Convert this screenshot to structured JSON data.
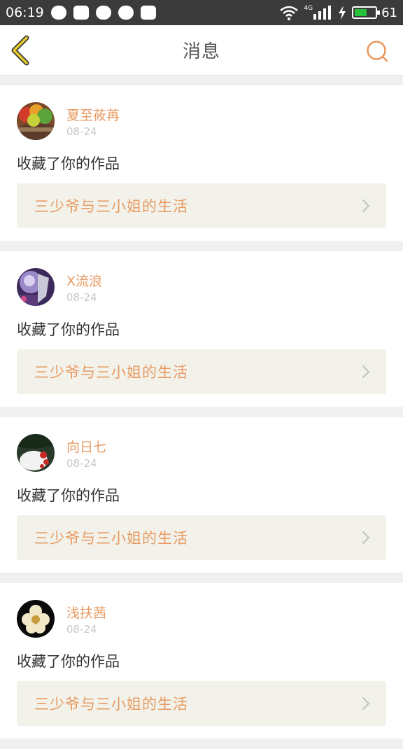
{
  "status_bar": {
    "time": "06:19",
    "network": "4G",
    "battery": "61",
    "battery_level": 0.61,
    "icons": [
      "message-bubble-icon",
      "qq-penguin-icon",
      "baidu-paw-icon",
      "wechat-icon",
      "pocket-icon",
      "wifi-icon",
      "signal-icon",
      "charging-bolt-icon",
      "battery-icon"
    ]
  },
  "header": {
    "title": "消息",
    "back_icon": "chevron-left-icon",
    "search_icon": "search-icon",
    "accent_color": "#e89a62",
    "back_color": "#e6c92a"
  },
  "messages": [
    {
      "user": "夏至莜苒",
      "date": "08-24",
      "action": "收藏了你的作品",
      "work": "三少爷与三小姐的生活"
    },
    {
      "user": "X流浪",
      "date": "08-24",
      "action": "收藏了你的作品",
      "work": "三少爷与三小姐的生活"
    },
    {
      "user": "向日七",
      "date": "08-24",
      "action": "收藏了你的作品",
      "work": "三少爷与三小姐的生活"
    },
    {
      "user": "浅扶茜",
      "date": "08-24",
      "action": "收藏了你的作品",
      "work": "三少爷与三小姐的生活"
    }
  ]
}
